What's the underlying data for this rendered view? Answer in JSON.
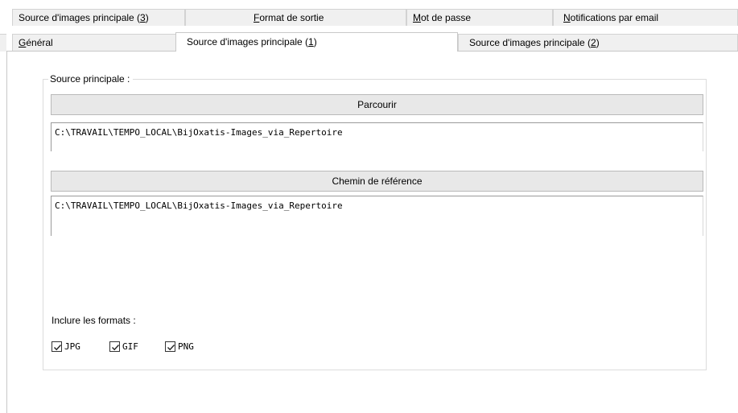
{
  "tabs_row_back": [
    {
      "label_pre": "Source d'images principale (",
      "label_key": "3",
      "label_post": ")"
    },
    {
      "label_pre": "",
      "label_key": "F",
      "label_post": "ormat de sortie"
    },
    {
      "label_pre": "",
      "label_key": "M",
      "label_post": "ot de passe"
    },
    {
      "label_pre": "",
      "label_key": "N",
      "label_post": "otifications par email"
    }
  ],
  "tabs_row_front": [
    {
      "label_pre": "",
      "label_key": "G",
      "label_post": "énéral"
    },
    {
      "label_pre": "Source d'images principale (",
      "label_key": "1",
      "label_post": ")"
    },
    {
      "label_pre": "Source d'images principale (",
      "label_key": "2",
      "label_post": ")"
    }
  ],
  "group": {
    "title": "Source principale :",
    "browse_button": "Parcourir",
    "main_path": "C:\\TRAVAIL\\TEMPO_LOCAL\\BijOxatis-Images_via_Repertoire",
    "reference_button": "Chemin de référence",
    "reference_path": "C:\\TRAVAIL\\TEMPO_LOCAL\\BijOxatis-Images_via_Repertoire",
    "formats_label": "Inclure les formats :",
    "formats": [
      {
        "label": "JPG",
        "checked": true
      },
      {
        "label": "GIF",
        "checked": true
      },
      {
        "label": "PNG",
        "checked": true
      }
    ]
  }
}
